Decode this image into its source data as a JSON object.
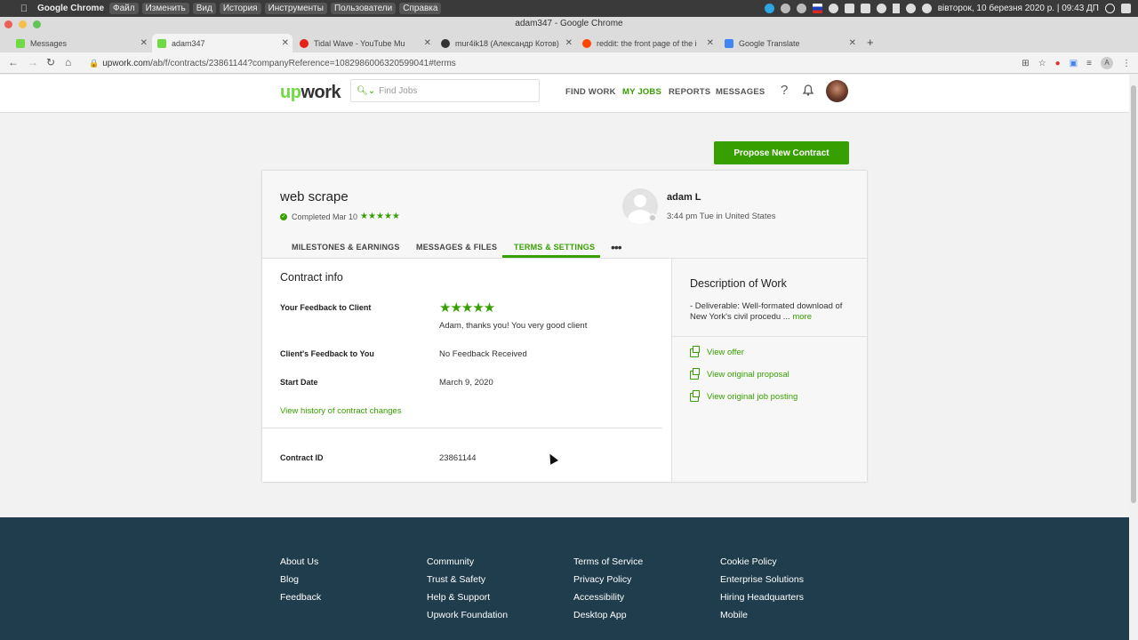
{
  "macbar": {
    "app_name": "Google Chrome",
    "menus": [
      "Файл",
      "Изменить",
      "Вид",
      "История",
      "Инструменты",
      "Пользователи",
      "Справка"
    ],
    "datetime": "вівторок, 10 березня 2020 р. | 09:43 ДП"
  },
  "window": {
    "title": "adam347 - Google Chrome"
  },
  "tabs": [
    {
      "label": "Messages",
      "favicon_color": "#6fda44"
    },
    {
      "label": "adam347",
      "favicon_color": "#6fda44"
    },
    {
      "label": "Tidal Wave - YouTube Mu",
      "favicon_color": "#e62117"
    },
    {
      "label": "mur4ik18 (Александр Котов)",
      "favicon_color": "#333333"
    },
    {
      "label": "reddit: the front page of the i",
      "favicon_color": "#ff4500"
    },
    {
      "label": "Google Translate",
      "favicon_color": "#4285f4"
    }
  ],
  "address": {
    "domain": "upwork.com",
    "path": "/ab/f/contracts/23861144?companyReference=1082986006320599041#terms"
  },
  "header": {
    "logo_up": "up",
    "logo_work": "work",
    "search_placeholder": "Find Jobs",
    "nav": [
      "FIND WORK",
      "MY JOBS",
      "REPORTS",
      "MESSAGES"
    ],
    "help": "?"
  },
  "propose_button": "Propose New Contract",
  "contract": {
    "title": "web scrape",
    "status": "Completed Mar 10",
    "stars": "★★★★★",
    "client_name": "adam L",
    "client_time": "3:44 pm Tue in United States",
    "tabs": [
      "MILESTONES & EARNINGS",
      "MESSAGES & FILES",
      "TERMS & SETTINGS"
    ],
    "more_tabs": "•••"
  },
  "info": {
    "heading": "Contract info",
    "your_feedback_label": "Your Feedback to Client",
    "your_feedback_stars": "★★★★★",
    "your_feedback_text": "Adam, thanks you! You very good client",
    "client_feedback_label": "Client's Feedback to You",
    "client_feedback_value": "No Feedback Received",
    "start_date_label": "Start Date",
    "start_date_value": "March 9, 2020",
    "history_link": "View history of contract changes",
    "contract_id_label": "Contract ID",
    "contract_id_value": "23861144"
  },
  "work": {
    "heading": "Description of Work",
    "description": "- Deliverable: Well-formated download of New York's civil procedu ...",
    "more": "more",
    "links": [
      "View offer",
      "View original proposal",
      "View original job posting"
    ]
  },
  "footer": {
    "col1": [
      "About Us",
      "Blog",
      "Feedback"
    ],
    "col2": [
      "Community",
      "Trust & Safety",
      "Help & Support",
      "Upwork Foundation"
    ],
    "col3": [
      "Terms of Service",
      "Privacy Policy",
      "Accessibility",
      "Desktop App"
    ],
    "col4": [
      "Cookie Policy",
      "Enterprise Solutions",
      "Hiring Headquarters",
      "Mobile"
    ]
  },
  "colors": {
    "brand": "#37a000",
    "logo": "#6fda44",
    "footer_bg": "#1f3d4d"
  }
}
